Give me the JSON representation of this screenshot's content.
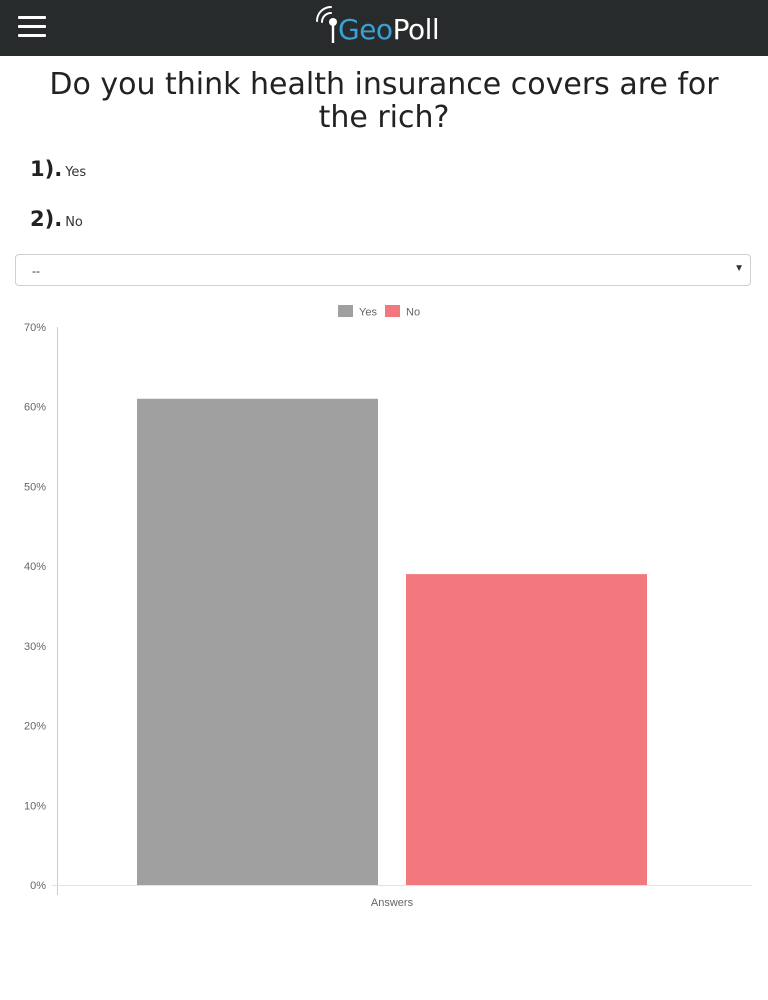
{
  "header": {
    "logo_text_geo": "Geo",
    "logo_text_poll": "Poll",
    "menu_icon": "hamburger-menu-icon",
    "background_color": "#282b2b",
    "brand_accent": "#3aa0d8"
  },
  "question": "Do you think health insurance covers are for the rich?",
  "answers": [
    {
      "number": "1).",
      "label": "Yes"
    },
    {
      "number": "2).",
      "label": "No"
    }
  ],
  "filter": {
    "selected": "--"
  },
  "chart_data": {
    "type": "bar",
    "categories": [
      "Answers"
    ],
    "series": [
      {
        "name": "Yes",
        "values": [
          61
        ],
        "color": "#a0a0a0"
      },
      {
        "name": "No",
        "values": [
          39
        ],
        "color": "#f2787e"
      }
    ],
    "xlabel": "Answers",
    "ylabel": "",
    "ylim": [
      0,
      70
    ],
    "yticks": [
      0,
      10,
      20,
      30,
      40,
      50,
      60,
      70
    ],
    "ytick_labels": [
      "0%",
      "10%",
      "20%",
      "30%",
      "40%",
      "50%",
      "60%",
      "70%"
    ],
    "legend_position": "top-center",
    "grid": false
  }
}
